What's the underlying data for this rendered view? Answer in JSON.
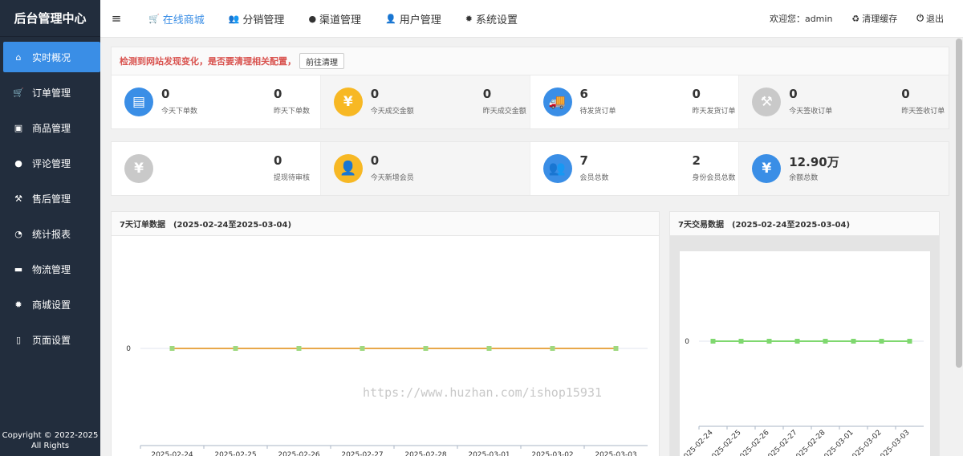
{
  "sidebar": {
    "brand": "后台管理中心",
    "items": [
      {
        "label": "实时概况",
        "icon": "home-icon",
        "glyph": "⌂"
      },
      {
        "label": "订单管理",
        "icon": "cart-icon",
        "glyph": "🛒"
      },
      {
        "label": "商品管理",
        "icon": "gift-icon",
        "glyph": "▣"
      },
      {
        "label": "评论管理",
        "icon": "comment-icon",
        "glyph": "●"
      },
      {
        "label": "售后管理",
        "icon": "gavel-icon",
        "glyph": "⚒"
      },
      {
        "label": "统计报表",
        "icon": "pie-chart-icon",
        "glyph": "◔"
      },
      {
        "label": "物流管理",
        "icon": "truck-icon",
        "glyph": "▬"
      },
      {
        "label": "商城设置",
        "icon": "gear-icon",
        "glyph": "✹"
      },
      {
        "label": "页面设置",
        "icon": "file-icon",
        "glyph": "▯"
      }
    ],
    "copyright_line1": "Copyright © 2022-2025",
    "copyright_line2": "All Rights"
  },
  "topbar": {
    "menu_glyph": "≡",
    "nav": [
      {
        "label": "在线商城",
        "icon": "cart-icon",
        "glyph": "🛒"
      },
      {
        "label": "分销管理",
        "icon": "users-icon",
        "glyph": "👥"
      },
      {
        "label": "渠道管理",
        "icon": "wechat-icon",
        "glyph": "●"
      },
      {
        "label": "用户管理",
        "icon": "user-icon",
        "glyph": "👤"
      },
      {
        "label": "系统设置",
        "icon": "gear-icon",
        "glyph": "✹"
      }
    ],
    "welcome": "欢迎您：admin",
    "clear_cache": "清理缓存",
    "clear_glyph": "♻",
    "logout": "退出",
    "logout_glyph": "⏻"
  },
  "alert": {
    "text": "检测到网站发现变化，是否要清理相关配置，",
    "button": "前往清理"
  },
  "stats_row1": [
    {
      "icon": "document-copy-icon",
      "glyph": "▤",
      "color": "blue",
      "value": "0",
      "label": "今天下单数",
      "value2": "0",
      "label2": "昨天下单数"
    },
    {
      "icon": "yen-icon",
      "glyph": "¥",
      "color": "yellow",
      "value": "0",
      "label": "今天成交金额",
      "value2": "0",
      "label2": "昨天成交金额"
    },
    {
      "icon": "truck-icon",
      "glyph": "🚚",
      "color": "blue",
      "value": "6",
      "label": "待发货订单",
      "value2": "0",
      "label2": "昨天发货订单"
    },
    {
      "icon": "gavel-icon",
      "glyph": "⚒",
      "color": "gray",
      "value": "0",
      "label": "今天签收订单",
      "value2": "0",
      "label2": "昨天签收订单"
    }
  ],
  "stats_row2": [
    {
      "icon": "yen-icon",
      "glyph": "¥",
      "color": "gray",
      "value": "",
      "label": "",
      "value2": "0",
      "label2": "提现待审核"
    },
    {
      "icon": "user-icon",
      "glyph": "👤",
      "color": "yellow",
      "value": "0",
      "label": "今天新增会员",
      "value2": "",
      "label2": ""
    },
    {
      "icon": "users-icon",
      "glyph": "👥",
      "color": "blue",
      "value": "7",
      "label": "会员总数",
      "value2": "2",
      "label2": "身份会员总数"
    },
    {
      "icon": "yen-icon",
      "glyph": "¥",
      "color": "blue",
      "value": "12.90万",
      "label": "余额总数",
      "value2": "",
      "label2": ""
    }
  ],
  "chart1": {
    "title": "7天订单数据",
    "range": "(2025-02-24至2025-03-04)"
  },
  "chart2": {
    "title": "7天交易数据",
    "range": "(2025-02-24至2025-03-04)"
  },
  "watermark": "https://www.huzhan.com/ishop15931",
  "colors": {
    "accent": "#3a8ee6",
    "sidebar": "#222d3d",
    "alert": "#d9534f",
    "line_orange": "#e8a84a",
    "marker_green": "#9fd87f",
    "line_green": "#7fd86f"
  },
  "chart_data": [
    {
      "type": "line",
      "categories": [
        "2025-02-24",
        "2025-02-25",
        "2025-02-26",
        "2025-02-27",
        "2025-02-28",
        "2025-03-01",
        "2025-03-02",
        "2025-03-03"
      ],
      "series": [
        {
          "values": [
            0,
            0,
            0,
            0,
            0,
            0,
            0,
            0
          ]
        }
      ],
      "ytick": "0",
      "grid": false
    },
    {
      "type": "line",
      "categories": [
        "2025-02-24",
        "2025-02-25",
        "2025-02-26",
        "2025-02-27",
        "2025-02-28",
        "2025-03-01",
        "2025-03-02",
        "2025-03-03"
      ],
      "series": [
        {
          "values": [
            0,
            0,
            0,
            0,
            0,
            0,
            0,
            0
          ]
        }
      ],
      "ytick": "0",
      "grid": false
    }
  ]
}
